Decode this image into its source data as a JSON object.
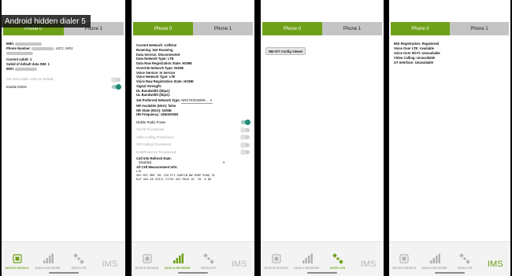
{
  "overlay_title": "Android hidden dialer 5",
  "tabs": [
    "Phone 0",
    "Phone 1"
  ],
  "nav": {
    "device": "DEVICE DETAILS",
    "data": "DATA & NETWORK",
    "satellite": "SATELLITE",
    "ims": "IMS"
  },
  "screen0": {
    "imei_label": "IMEI:",
    "phone_label": "Phone Number:",
    "phone_suffix": ", UICC, IMSI:",
    "current_subid": "Current subId: 1",
    "default_subid": "SubId of default data SIM: 1",
    "imsi_label": "IMSI:",
    "set_removable": "Set Removable eSIM as Default",
    "enable_dsds": "Enable DSDS"
  },
  "screen1": {
    "current_network": "Current Network: CellOne",
    "roaming": "Roaming: Not Roaming",
    "data_service": "Data Service: Disconnected",
    "data_network_type": "Data Network Type: LTE",
    "data_raw_reg": "Data Raw Registration State: HOME",
    "override_type": "Override Network Type: NONE",
    "voice_service": "Voice Service: In Service",
    "voice_network_type": "Voice Network Type: LTE",
    "voice_raw_reg": "Voice Raw Registration State: HOME",
    "signal_strength": "Signal Strength:",
    "dl_bandwidth": "DL Bandwidth (kbps):",
    "ul_bandwidth": "UL Bandwidth (kbps):",
    "pref_network_label": "Set Preferred Network Type:",
    "pref_network_value": "NR/LTE/GSM/W...",
    "nr_available": "NR Available (NSA): false",
    "nr_state": "NR State (NSA): NONE",
    "nr_frequency": "NR Frequency: UNKNOWN",
    "mobile_radio_power": "Mobile Radio Power",
    "volte": "VoLTE Provisioned",
    "video_calling": "Video Calling Provisioned",
    "wifi_calling": "Wifi Calling Provisioned",
    "eab": "EAB/Presence Provisioned",
    "cell_refresh_label": "Cell Info Refresh Rate:",
    "cell_refresh_value": "Disabled",
    "all_cell_label": "All Cell Measurement Info:",
    "cell_tech": "LTE",
    "cell_header": "SRV MCC MNC TAC   CID    PCI EARFCN BW RSRP RSRQ TA",
    "cell_row": "R+P 404 58  52512 21735  452 9610   10 -78  -6   86"
  },
  "screen2": {
    "nbiot_button": "NB-IOT Config Viewer"
  },
  "screen3": {
    "ims_registration": "IMS Registration: Registered",
    "voice_over_lte": "Voice Over LTE: Available",
    "voice_over_wifi": "Voice Over Wi-Fi: Unavailable",
    "video_calling": "Video Calling: Unavailable",
    "ut_interface": "UT Interface: Unavailable"
  },
  "colors": {
    "accent_green": "#6ea118",
    "tab_inactive": "#c4c4c4",
    "toggle_on": "#1f8a78"
  },
  "icons": [
    "device-details-icon",
    "signal-bars-icon",
    "satellite-icon",
    "ims-text-icon"
  ]
}
